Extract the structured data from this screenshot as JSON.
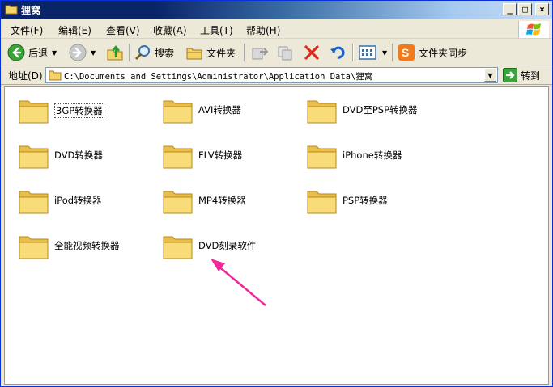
{
  "window": {
    "title": "狸窝",
    "buttons": {
      "minimize": "_",
      "maximize": "□",
      "close": "×"
    }
  },
  "menu": [
    {
      "label": "文件(F)"
    },
    {
      "label": "编辑(E)"
    },
    {
      "label": "查看(V)"
    },
    {
      "label": "收藏(A)"
    },
    {
      "label": "工具(T)"
    },
    {
      "label": "帮助(H)"
    }
  ],
  "toolbar": {
    "back_label": "后退",
    "search_label": "搜索",
    "folders_label": "文件夹",
    "sync_label": "文件夹同步"
  },
  "address": {
    "label": "地址(D)",
    "path": "C:\\Documents and Settings\\Administrator\\Application Data\\狸窝",
    "go_label": "转到"
  },
  "folders": [
    {
      "name": "3GP转换器",
      "selected": true
    },
    {
      "name": "AVI转换器"
    },
    {
      "name": "DVD至PSP转换器"
    },
    {
      "name": "DVD转换器"
    },
    {
      "name": "FLV转换器"
    },
    {
      "name": "iPhone转换器"
    },
    {
      "name": "iPod转换器"
    },
    {
      "name": "MP4转换器"
    },
    {
      "name": "PSP转换器"
    },
    {
      "name": "全能视频转换器"
    },
    {
      "name": "DVD刻录软件"
    }
  ],
  "colors": {
    "titlebar_dark": "#0a246a",
    "annotation_arrow": "#ee2a9c",
    "folder_fill": "#f8dc7a"
  }
}
